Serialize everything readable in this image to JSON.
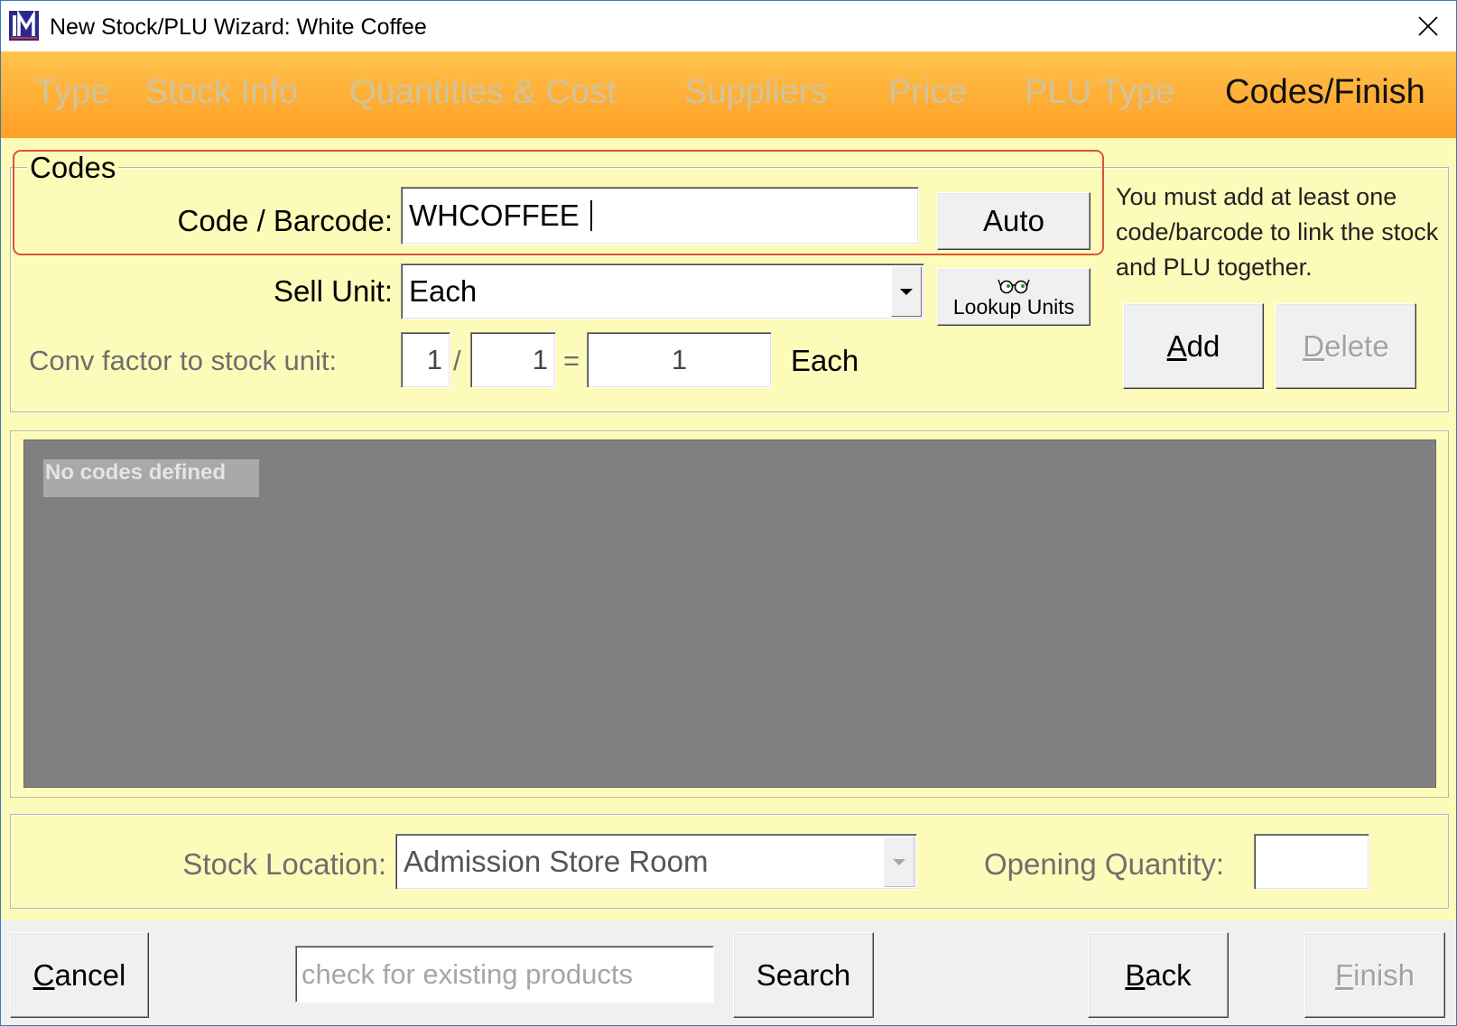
{
  "window": {
    "title": "New Stock/PLU Wizard: White Coffee",
    "icon": "app-logo-icon",
    "close_icon": "close-icon"
  },
  "tabs": [
    {
      "label": "Type",
      "active": false
    },
    {
      "label": "Stock Info",
      "active": false
    },
    {
      "label": "Quantities & Cost",
      "active": false
    },
    {
      "label": "Suppliers",
      "active": false
    },
    {
      "label": "Price",
      "active": false
    },
    {
      "label": "PLU Type",
      "active": false
    },
    {
      "label": "Codes/Finish",
      "active": true
    }
  ],
  "codes": {
    "legend": "Codes",
    "code_label": "Code / Barcode:",
    "code_value": "WHCOFFEE",
    "auto_label": "Auto",
    "sell_unit_label": "Sell Unit:",
    "sell_unit_value": "Each",
    "lookup_icon": "glasses-icon",
    "lookup_units_label": "Lookup Units",
    "conv_label": "Conv factor to stock unit:",
    "conv_numerator": "1",
    "conv_slash": "/",
    "conv_denominator": "1",
    "conv_equals": "=",
    "conv_result": "1",
    "conv_unit": "Each",
    "help_text": "You must add at least one code/barcode to link the stock and PLU together.",
    "add_label": "Add",
    "delete_label": "Delete",
    "delete_enabled": false
  },
  "codes_list": {
    "empty_text": "No codes defined"
  },
  "stock": {
    "location_label": "Stock Location:",
    "location_value": "Admission Store Room",
    "opening_qty_label": "Opening Quantity:"
  },
  "footer": {
    "cancel_label": "Cancel",
    "search_placeholder": "check for existing products",
    "search_label": "Search",
    "back_label": "Back",
    "finish_label": "Finish",
    "finish_enabled": false
  },
  "colors": {
    "header_orange": "#ffa82c",
    "panel_yellow": "#fdfbb9",
    "list_gray": "#808080",
    "highlight_red": "#d9533b",
    "inactive_tab": "#cfc49c"
  }
}
